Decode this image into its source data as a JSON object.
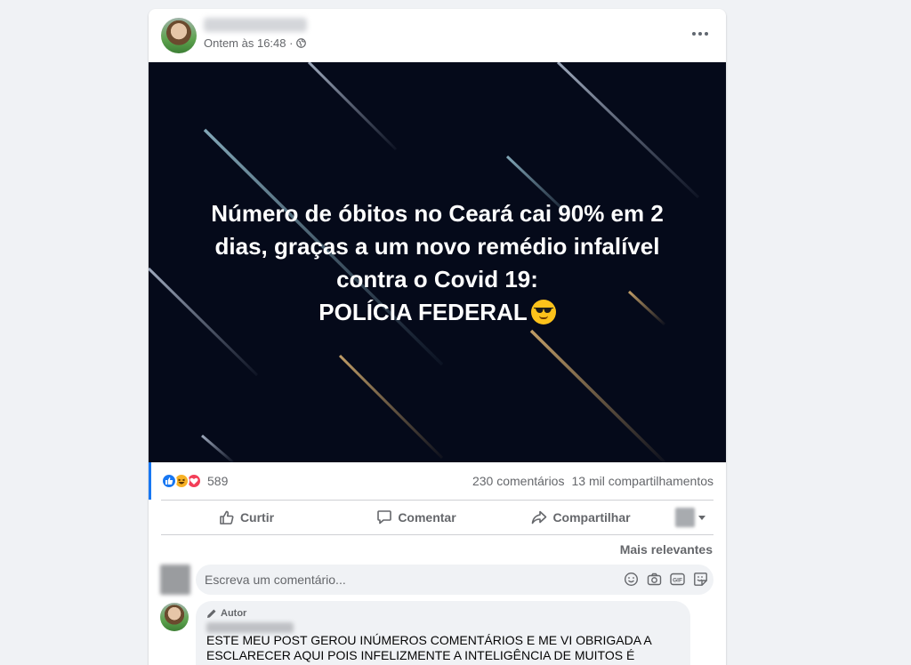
{
  "post": {
    "timestamp": "Ontem às 16:48 ·",
    "image_text": {
      "line1": "Número de óbitos no Ceará cai 90% em 2",
      "line2": "dias, graças a um novo remédio infalível",
      "line3": "contra o Covid 19:",
      "line4": "POLÍCIA FEDERAL"
    },
    "emoji": "smiling-face-with-sunglasses"
  },
  "stats": {
    "reaction_count": "589",
    "comments": "230 comentários",
    "shares": "13 mil compartilhamentos",
    "reaction_types": [
      "like",
      "haha",
      "love"
    ]
  },
  "actions": {
    "like": "Curtir",
    "comment": "Comentar",
    "share": "Compartilhar"
  },
  "comments_section": {
    "sort_label": "Mais relevantes",
    "composer_placeholder": "Escreva um comentário...",
    "composer_icons": [
      "emoji-icon",
      "camera-icon",
      "gif-icon",
      "sticker-icon"
    ]
  },
  "top_comment": {
    "badge": "Autor",
    "text_line1": "ESTE MEU POST GEROU INÚMEROS COMENTÁRIOS E ME VI OBRIGADA A",
    "text_line2": "ESCLARECER AQUI POIS INFELIZMENTE A INTELIGÊNCIA DE MUITOS É"
  },
  "colors": {
    "background": "#f0f2f5",
    "card": "#ffffff",
    "accent": "#1877f2",
    "secondary_text": "#65676b",
    "image_background": "#050a1a"
  }
}
